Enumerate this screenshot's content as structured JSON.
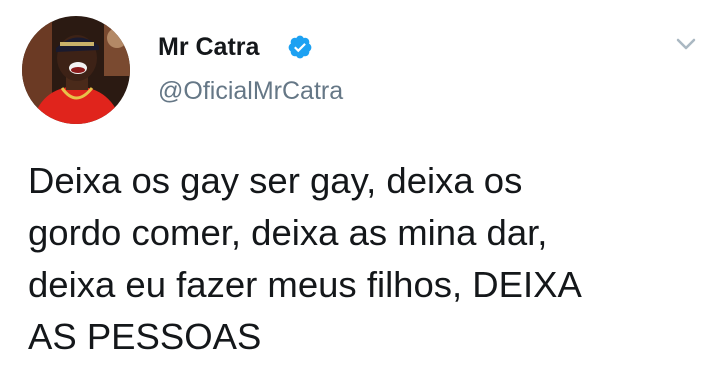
{
  "tweet": {
    "author": {
      "display_name": "Mr Catra",
      "handle": "@OficialMrCatra",
      "verified": true,
      "avatar_icon": "profile-photo-man-red-shirt"
    },
    "text": "Deixa os gay ser gay, deixa os\ngordo comer, deixa as mina dar,\ndeixa eu fazer meus filhos, DEIXA\nAS PESSOAS",
    "menu_icon": "chevron-down-icon"
  },
  "colors": {
    "verified_blue": "#1da1f2",
    "handle_gray": "#657786",
    "text_black": "#14171a",
    "caret_gray": "#aab8c2"
  }
}
